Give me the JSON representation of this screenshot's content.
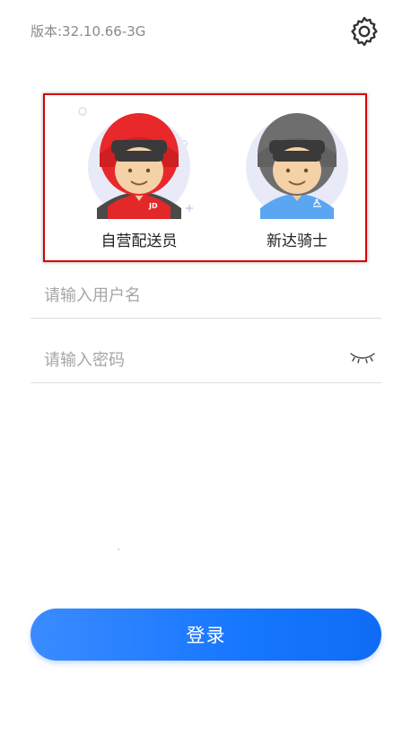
{
  "header": {
    "version": "版本:32.10.66-3G",
    "settings_icon": "gear-icon"
  },
  "roles": [
    {
      "label": "自营配送员",
      "selected": true,
      "helmet_color": "#e8282a",
      "shirt_color": "#e02a1e",
      "badge": "JD"
    },
    {
      "label": "新达骑士",
      "selected": false,
      "helmet_color": "#6e6e6e",
      "shirt_color": "#5aa6f2",
      "badge": ""
    }
  ],
  "form": {
    "username_placeholder": "请输入用户名",
    "password_placeholder": "请输入密码",
    "eye_icon": "eye-closed-icon"
  },
  "login_label": "登录",
  "colors": {
    "accent": "#1677ff",
    "selection_border": "#d90000"
  }
}
